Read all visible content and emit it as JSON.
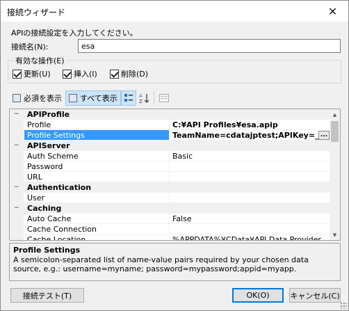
{
  "window": {
    "title": "接続ウィザード",
    "close_glyph": "✕"
  },
  "intro": "APIの接続設定を入力してください。",
  "connection_name": {
    "label": "接続名(N):",
    "value": "esa"
  },
  "operations": {
    "legend": "有効な操作(E)",
    "items": [
      {
        "label": "更新(U)",
        "checked": true
      },
      {
        "label": "挿入(I)",
        "checked": true
      },
      {
        "label": "削除(D)",
        "checked": true
      }
    ]
  },
  "toolbar": {
    "required_label": "必須を表示",
    "all_label": "すべて表示",
    "categorized_icon": "categorized-icon",
    "alpha_sort_icon": "alphabetical-sort-icon",
    "property_pages_icon": "property-pages-icon"
  },
  "grid": {
    "rows": [
      {
        "type": "category",
        "name": "APIProfile",
        "toggle": "−"
      },
      {
        "type": "prop",
        "name": "Profile",
        "value": "C:¥API Profiles¥esa.apip",
        "bold": true
      },
      {
        "type": "prop",
        "name": "Profile Settings",
        "value": "TeamName=cdatajptest;APIKey=_gt",
        "bold": true,
        "selected": true,
        "ellipsis": "..."
      },
      {
        "type": "category",
        "name": "APIServer",
        "toggle": "−"
      },
      {
        "type": "prop",
        "name": "Auth Scheme",
        "value": "Basic"
      },
      {
        "type": "prop",
        "name": "Password",
        "value": ""
      },
      {
        "type": "prop",
        "name": "URL",
        "value": ""
      },
      {
        "type": "category",
        "name": "Authentication",
        "toggle": "−"
      },
      {
        "type": "prop",
        "name": "User",
        "value": ""
      },
      {
        "type": "category",
        "name": "Caching",
        "toggle": "−"
      },
      {
        "type": "prop",
        "name": "Auto Cache",
        "value": "False"
      },
      {
        "type": "prop",
        "name": "Cache Connection",
        "value": ""
      },
      {
        "type": "prop",
        "name": "Cache Location",
        "value": "%APPDATA%¥CData¥API Data Provider"
      }
    ]
  },
  "description": {
    "title": "Profile Settings",
    "text": "A semicolon-separated list of name-value pairs required by your chosen data source, e.g.: username=myname; password=mypassword;appid=myapp."
  },
  "buttons": {
    "test": "接続テスト(T)",
    "ok": "OK(O)",
    "cancel": "キャンセル(C)"
  }
}
